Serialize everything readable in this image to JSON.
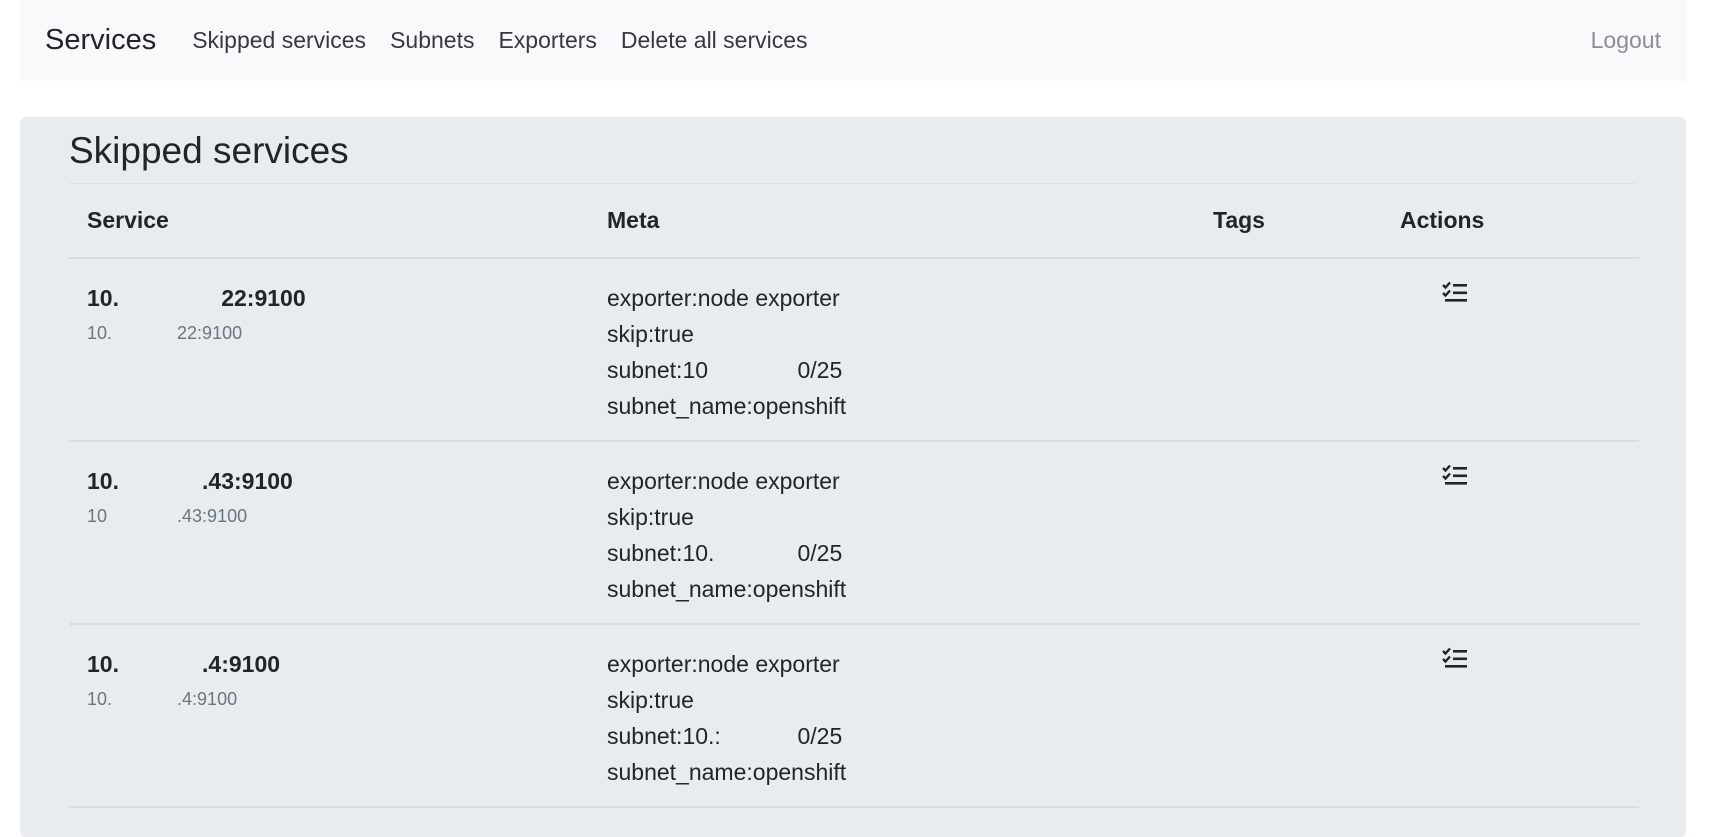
{
  "navbar": {
    "brand": "Services",
    "links": [
      "Skipped services",
      "Subnets",
      "Exporters",
      "Delete all services"
    ],
    "logout": "Logout"
  },
  "page": {
    "title": "Skipped services"
  },
  "table": {
    "headers": [
      "Service",
      "Meta",
      "Tags",
      "Actions"
    ],
    "rows": [
      {
        "service_main": "10.                22:9100",
        "service_sub": "10.             22:9100",
        "meta": [
          "exporter:node exporter",
          "skip:true",
          "subnet:10              0/25",
          "subnet_name:openshift"
        ],
        "tags": ""
      },
      {
        "service_main": "10.             .43:9100",
        "service_sub": "10              .43:9100",
        "meta": [
          "exporter:node exporter",
          "skip:true",
          "subnet:10.             0/25",
          "subnet_name:openshift"
        ],
        "tags": ""
      },
      {
        "service_main": "10.             .4:9100",
        "service_sub": "10.             .4:9100",
        "meta": [
          "exporter:node exporter",
          "skip:true",
          "subnet:10.:            0/25",
          "subnet_name:openshift"
        ],
        "tags": ""
      }
    ]
  },
  "icons": {
    "action": "list-check-icon"
  }
}
